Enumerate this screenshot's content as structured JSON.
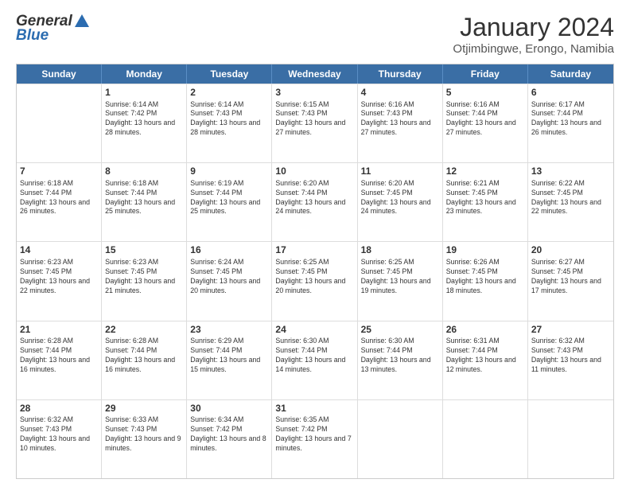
{
  "header": {
    "logo_general": "General",
    "logo_blue": "Blue",
    "month_title": "January 2024",
    "subtitle": "Otjimbingwe, Erongo, Namibia"
  },
  "weekdays": [
    "Sunday",
    "Monday",
    "Tuesday",
    "Wednesday",
    "Thursday",
    "Friday",
    "Saturday"
  ],
  "rows": [
    [
      {
        "day": "",
        "sunrise": "",
        "sunset": "",
        "daylight": ""
      },
      {
        "day": "1",
        "sunrise": "Sunrise: 6:14 AM",
        "sunset": "Sunset: 7:42 PM",
        "daylight": "Daylight: 13 hours and 28 minutes."
      },
      {
        "day": "2",
        "sunrise": "Sunrise: 6:14 AM",
        "sunset": "Sunset: 7:43 PM",
        "daylight": "Daylight: 13 hours and 28 minutes."
      },
      {
        "day": "3",
        "sunrise": "Sunrise: 6:15 AM",
        "sunset": "Sunset: 7:43 PM",
        "daylight": "Daylight: 13 hours and 27 minutes."
      },
      {
        "day": "4",
        "sunrise": "Sunrise: 6:16 AM",
        "sunset": "Sunset: 7:43 PM",
        "daylight": "Daylight: 13 hours and 27 minutes."
      },
      {
        "day": "5",
        "sunrise": "Sunrise: 6:16 AM",
        "sunset": "Sunset: 7:44 PM",
        "daylight": "Daylight: 13 hours and 27 minutes."
      },
      {
        "day": "6",
        "sunrise": "Sunrise: 6:17 AM",
        "sunset": "Sunset: 7:44 PM",
        "daylight": "Daylight: 13 hours and 26 minutes."
      }
    ],
    [
      {
        "day": "7",
        "sunrise": "Sunrise: 6:18 AM",
        "sunset": "Sunset: 7:44 PM",
        "daylight": "Daylight: 13 hours and 26 minutes."
      },
      {
        "day": "8",
        "sunrise": "Sunrise: 6:18 AM",
        "sunset": "Sunset: 7:44 PM",
        "daylight": "Daylight: 13 hours and 25 minutes."
      },
      {
        "day": "9",
        "sunrise": "Sunrise: 6:19 AM",
        "sunset": "Sunset: 7:44 PM",
        "daylight": "Daylight: 13 hours and 25 minutes."
      },
      {
        "day": "10",
        "sunrise": "Sunrise: 6:20 AM",
        "sunset": "Sunset: 7:44 PM",
        "daylight": "Daylight: 13 hours and 24 minutes."
      },
      {
        "day": "11",
        "sunrise": "Sunrise: 6:20 AM",
        "sunset": "Sunset: 7:45 PM",
        "daylight": "Daylight: 13 hours and 24 minutes."
      },
      {
        "day": "12",
        "sunrise": "Sunrise: 6:21 AM",
        "sunset": "Sunset: 7:45 PM",
        "daylight": "Daylight: 13 hours and 23 minutes."
      },
      {
        "day": "13",
        "sunrise": "Sunrise: 6:22 AM",
        "sunset": "Sunset: 7:45 PM",
        "daylight": "Daylight: 13 hours and 22 minutes."
      }
    ],
    [
      {
        "day": "14",
        "sunrise": "Sunrise: 6:23 AM",
        "sunset": "Sunset: 7:45 PM",
        "daylight": "Daylight: 13 hours and 22 minutes."
      },
      {
        "day": "15",
        "sunrise": "Sunrise: 6:23 AM",
        "sunset": "Sunset: 7:45 PM",
        "daylight": "Daylight: 13 hours and 21 minutes."
      },
      {
        "day": "16",
        "sunrise": "Sunrise: 6:24 AM",
        "sunset": "Sunset: 7:45 PM",
        "daylight": "Daylight: 13 hours and 20 minutes."
      },
      {
        "day": "17",
        "sunrise": "Sunrise: 6:25 AM",
        "sunset": "Sunset: 7:45 PM",
        "daylight": "Daylight: 13 hours and 20 minutes."
      },
      {
        "day": "18",
        "sunrise": "Sunrise: 6:25 AM",
        "sunset": "Sunset: 7:45 PM",
        "daylight": "Daylight: 13 hours and 19 minutes."
      },
      {
        "day": "19",
        "sunrise": "Sunrise: 6:26 AM",
        "sunset": "Sunset: 7:45 PM",
        "daylight": "Daylight: 13 hours and 18 minutes."
      },
      {
        "day": "20",
        "sunrise": "Sunrise: 6:27 AM",
        "sunset": "Sunset: 7:45 PM",
        "daylight": "Daylight: 13 hours and 17 minutes."
      }
    ],
    [
      {
        "day": "21",
        "sunrise": "Sunrise: 6:28 AM",
        "sunset": "Sunset: 7:44 PM",
        "daylight": "Daylight: 13 hours and 16 minutes."
      },
      {
        "day": "22",
        "sunrise": "Sunrise: 6:28 AM",
        "sunset": "Sunset: 7:44 PM",
        "daylight": "Daylight: 13 hours and 16 minutes."
      },
      {
        "day": "23",
        "sunrise": "Sunrise: 6:29 AM",
        "sunset": "Sunset: 7:44 PM",
        "daylight": "Daylight: 13 hours and 15 minutes."
      },
      {
        "day": "24",
        "sunrise": "Sunrise: 6:30 AM",
        "sunset": "Sunset: 7:44 PM",
        "daylight": "Daylight: 13 hours and 14 minutes."
      },
      {
        "day": "25",
        "sunrise": "Sunrise: 6:30 AM",
        "sunset": "Sunset: 7:44 PM",
        "daylight": "Daylight: 13 hours and 13 minutes."
      },
      {
        "day": "26",
        "sunrise": "Sunrise: 6:31 AM",
        "sunset": "Sunset: 7:44 PM",
        "daylight": "Daylight: 13 hours and 12 minutes."
      },
      {
        "day": "27",
        "sunrise": "Sunrise: 6:32 AM",
        "sunset": "Sunset: 7:43 PM",
        "daylight": "Daylight: 13 hours and 11 minutes."
      }
    ],
    [
      {
        "day": "28",
        "sunrise": "Sunrise: 6:32 AM",
        "sunset": "Sunset: 7:43 PM",
        "daylight": "Daylight: 13 hours and 10 minutes."
      },
      {
        "day": "29",
        "sunrise": "Sunrise: 6:33 AM",
        "sunset": "Sunset: 7:43 PM",
        "daylight": "Daylight: 13 hours and 9 minutes."
      },
      {
        "day": "30",
        "sunrise": "Sunrise: 6:34 AM",
        "sunset": "Sunset: 7:42 PM",
        "daylight": "Daylight: 13 hours and 8 minutes."
      },
      {
        "day": "31",
        "sunrise": "Sunrise: 6:35 AM",
        "sunset": "Sunset: 7:42 PM",
        "daylight": "Daylight: 13 hours and 7 minutes."
      },
      {
        "day": "",
        "sunrise": "",
        "sunset": "",
        "daylight": ""
      },
      {
        "day": "",
        "sunrise": "",
        "sunset": "",
        "daylight": ""
      },
      {
        "day": "",
        "sunrise": "",
        "sunset": "",
        "daylight": ""
      }
    ]
  ]
}
